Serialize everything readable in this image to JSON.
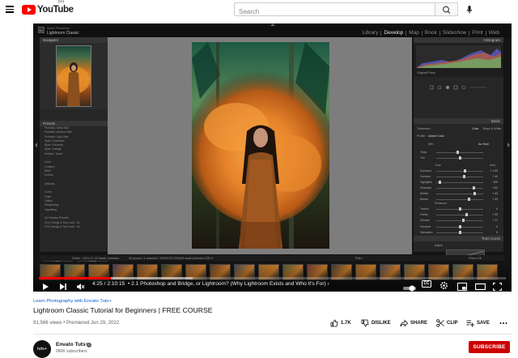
{
  "masthead": {
    "logo_text": "YouTube",
    "country_code": "PH",
    "search_placeholder": "Search"
  },
  "lightroom": {
    "app_line1": "Adobe Photoshop",
    "app_line2": "Lightroom Classic",
    "modules": [
      {
        "label": "Library",
        "active": false
      },
      {
        "label": "Develop",
        "active": true
      },
      {
        "label": "Map",
        "active": false
      },
      {
        "label": "Book",
        "active": false
      },
      {
        "label": "Slideshow",
        "active": false
      },
      {
        "label": "Print",
        "active": false
      },
      {
        "label": "Web",
        "active": false
      }
    ],
    "left_panel": {
      "navigator_label": "Navigator",
      "presets_label": "Presets",
      "preset_items": [
        "Portraits: Deep Skin",
        "Portraits: Medium Skin",
        "Portraits: Light Skin",
        "Style: Cinematic",
        "Style: Futuristic",
        "Style: Vintage",
        "Subject: Travel",
        "",
        "Color",
        "Creative",
        "B&W",
        "Curves",
        "",
        "Defaults",
        "",
        "Curve",
        "Grain",
        "Optics",
        "Sharpening",
        "Vignetting",
        "",
        "A1 Fashion Presets",
        "  C01 Orange & Teal Look - A1",
        "  C02 Orange & Teal Look - A2"
      ],
      "copy_label": "Copy...",
      "paste_label": "Paste"
    },
    "right_panel": {
      "histogram_label": "Histogram",
      "original_photo": "Original Photo",
      "basic_label": "Basic",
      "treatment": "Treatment :",
      "color_opt": "Color",
      "bw_opt": "Black & White",
      "profile": "Profile :",
      "profile_value": "Adobe Color",
      "wb": "WB :",
      "wb_value": "As Shot",
      "tone": "Tone",
      "auto": "Auto",
      "presence": "Presence",
      "tone_curve_label": "Tone Curve",
      "adjust": "Adjust",
      "sliders": [
        {
          "label": "Temp",
          "value": "",
          "pos": 0.45
        },
        {
          "label": "Tint",
          "value": "",
          "pos": 0.5
        },
        {
          "label": "Exposure",
          "value": "+ 1.05",
          "pos": 0.62
        },
        {
          "label": "Contrast",
          "value": "+ 42",
          "pos": 0.6
        },
        {
          "label": "Highlights",
          "value": "- 100",
          "pos": 0.08
        },
        {
          "label": "Shadows",
          "value": "+ 62",
          "pos": 0.8
        },
        {
          "label": "Whites",
          "value": "+ 63",
          "pos": 0.82
        },
        {
          "label": "Blacks",
          "value": "+ 43",
          "pos": 0.7
        },
        {
          "label": "Texture",
          "value": "0",
          "pos": 0.5
        },
        {
          "label": "Clarity",
          "value": "+ 30",
          "pos": 0.65
        },
        {
          "label": "Dehaze",
          "value": "+ 17",
          "pos": 0.58
        },
        {
          "label": "Vibrance",
          "value": "0",
          "pos": 0.5
        },
        {
          "label": "Saturation",
          "value": "0",
          "pos": 0.5
        }
      ],
      "previous_label": "Previous",
      "reset_label": "Reset"
    },
    "toolbar": {
      "left_text": "Folder : 2021-07-16 Sarah Johnston",
      "count_text": "46 photos / 1 selected / 20200702-DS5409 sarah johnston-CR2 ▾",
      "filter": "Filter :",
      "filters_off": "Filters Off"
    }
  },
  "player": {
    "progress": 0.155,
    "loaded": 0.33,
    "time_current": "4:25",
    "time_total": "2:10:15",
    "chapter": "• 2.1 Photoshop and Bridge, or Lightroom? (Why Lightroom Exists and Who It's For) ›",
    "cc": "CC"
  },
  "video": {
    "channel_tag": "Learn Photography with Envato Tuts+",
    "title": "Lightroom Classic Tutorial for Beginners | FREE COURSE",
    "views_line": "91,566 views • Premiered Jun 29, 2022",
    "actions": {
      "like": "1.7K",
      "dislike": "DISLIKE",
      "share": "SHARE",
      "clip": "CLIP",
      "save": "SAVE"
    }
  },
  "channel": {
    "avatar_text": "tuts+",
    "name": "Envato Tuts+",
    "subs": "990K subscribers",
    "subscribe": "SUBSCRIBE"
  },
  "colors": {
    "youtube_red": "#ff0000",
    "progress_red": "#ff0000",
    "subscribe_red": "#cc0000",
    "link_blue": "#065fd4"
  }
}
